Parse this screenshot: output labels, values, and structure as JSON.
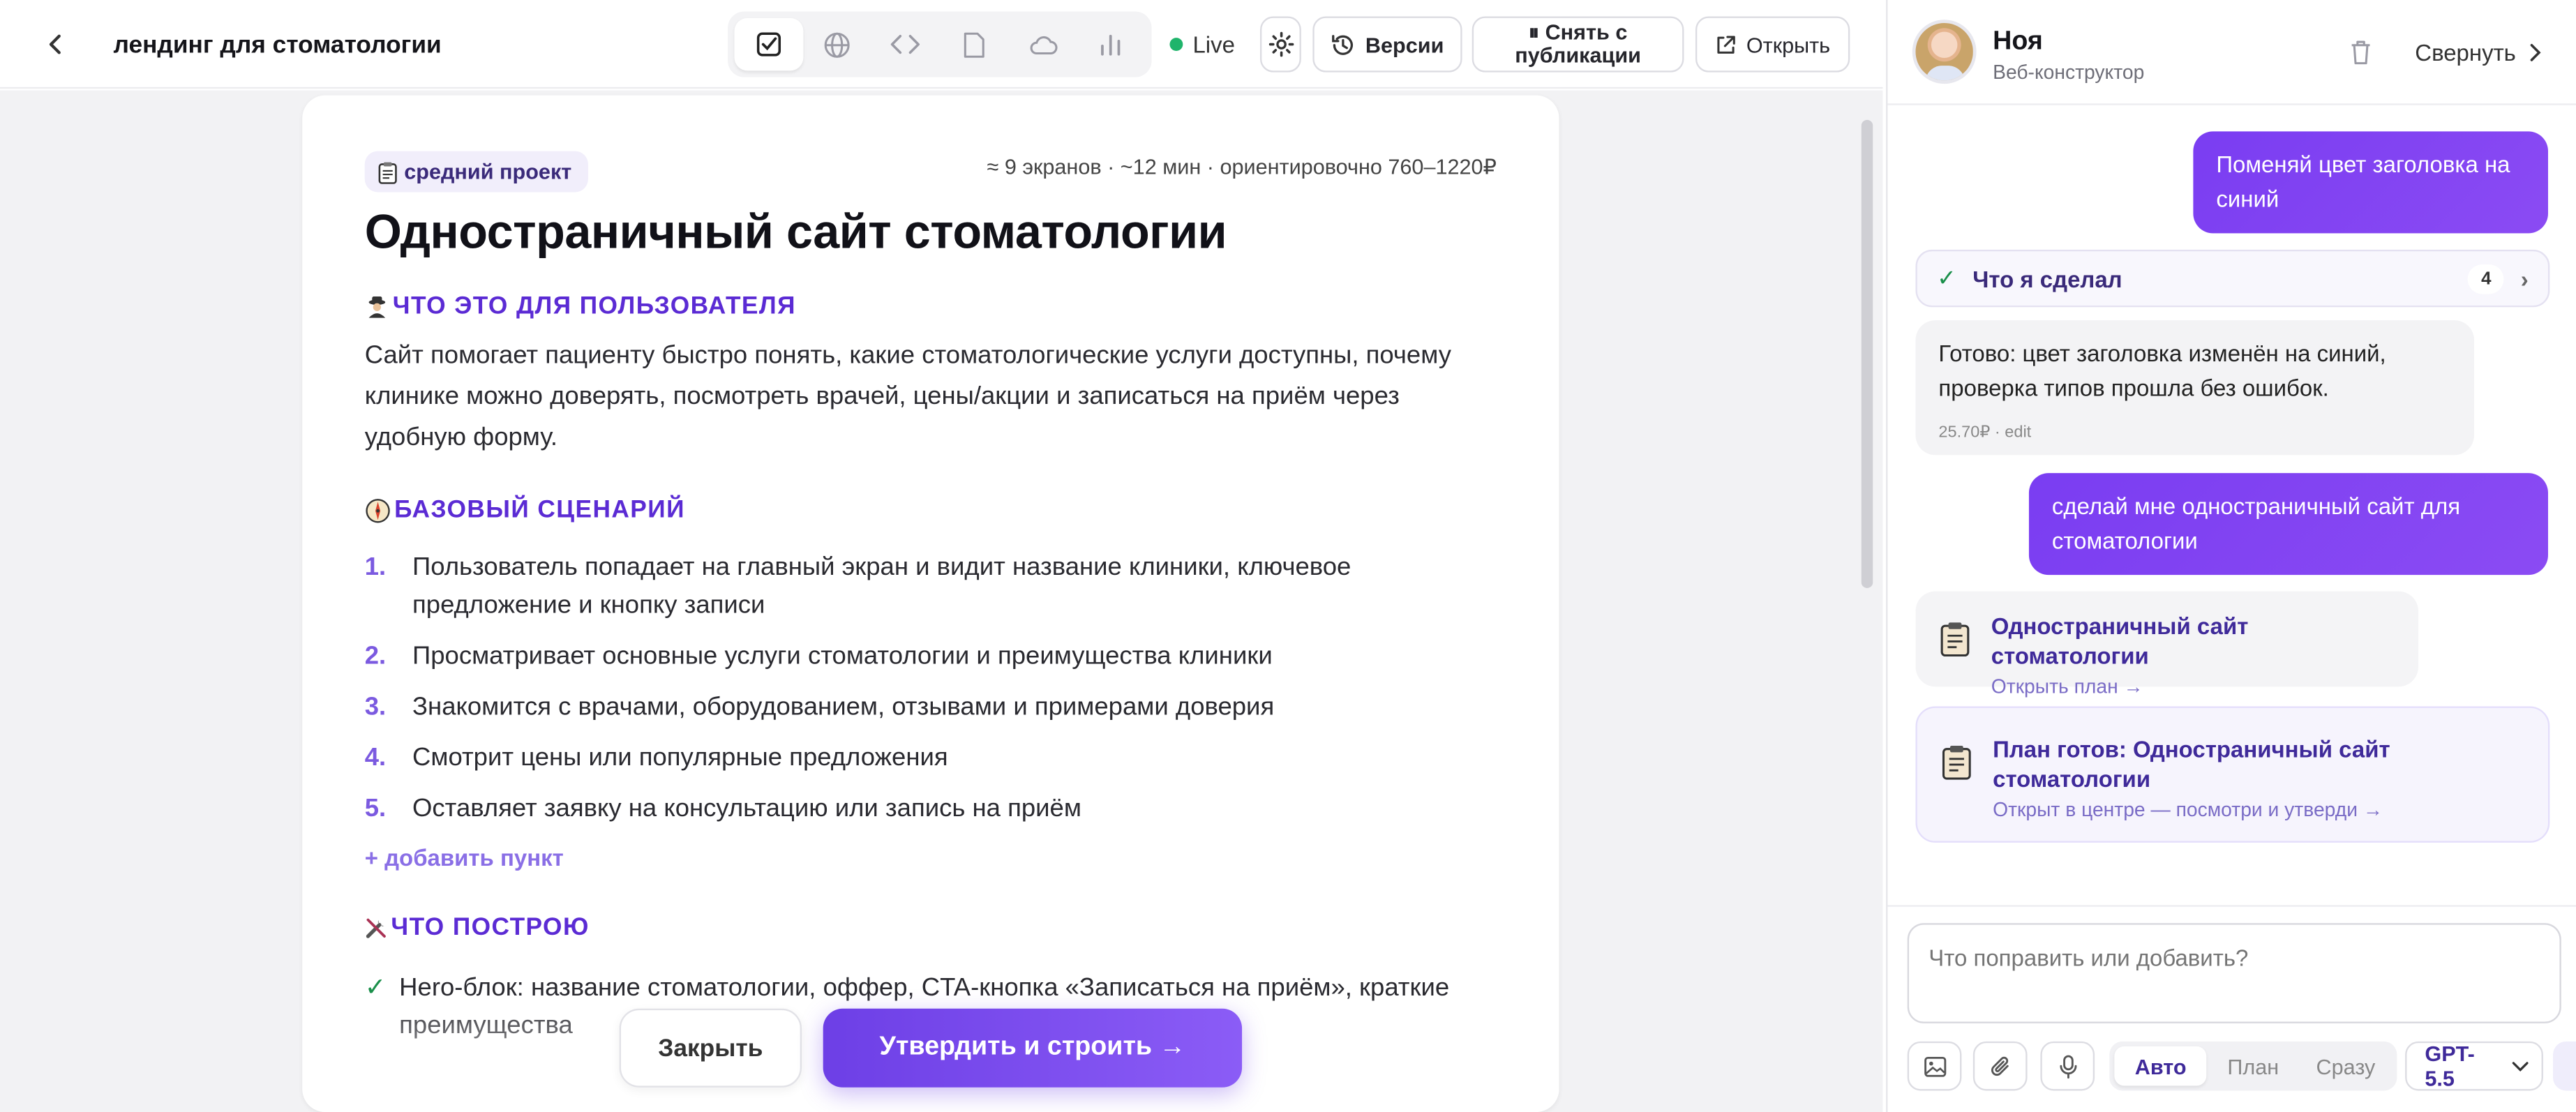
{
  "topbar": {
    "project_title": "лендинг для стоматологии",
    "live_label": "Live",
    "versions_label": "Версии",
    "unpublish_label": "⏸ Снять с публикации",
    "open_label": "Открыть",
    "modes": [
      "checklist-icon",
      "globe-icon",
      "code-icon",
      "file-icon",
      "cloud-icon",
      "chart-icon"
    ],
    "accent_live": "#1fb46b"
  },
  "plan": {
    "badge": "средний проект",
    "meta": "≈ 9 экранов · ~12 мин · ориентировочно 760–1220₽",
    "title": "Одностраничный сайт стоматологии",
    "section_user": "ЧТО ЭТО ДЛЯ ПОЛЬЗОВАТЕЛЯ",
    "user_text": "Сайт помогает пациенту быстро понять, какие стоматологические услуги доступны, почему клинике можно доверять, посмотреть врачей, цены/акции и записаться на приём через удобную форму.",
    "section_scenario": "БАЗОВЫЙ СЦЕНАРИЙ",
    "steps": [
      {
        "num": "1.",
        "text": "Пользователь попадает на главный экран и видит название клиники, ключевое предложение и кнопку записи"
      },
      {
        "num": "2.",
        "text": "Просматривает основные услуги стоматологии и преимущества клиники"
      },
      {
        "num": "3.",
        "text": "Знакомится с врачами, оборудованием, отзывами и примерами доверия"
      },
      {
        "num": "4.",
        "text": "Смотрит цены или популярные предложения"
      },
      {
        "num": "5.",
        "text": "Оставляет заявку на консультацию или запись на приём"
      }
    ],
    "add_item": "+ добавить пункт",
    "section_build": "ЧТО ПОСТРОЮ",
    "build_items": [
      "Hero-блок: название стоматологии, оффер, CTA-кнопка «Записаться на приём», краткие преимущества"
    ],
    "close_label": "Закрыть",
    "approve_label": "Утвердить и строить →",
    "accent": "#5b2bd4"
  },
  "chat": {
    "agent_name": "Ноя",
    "agent_role": "Веб-конструктор",
    "collapse_label": "Свернуть",
    "msg_user_1": "Поменяй цвет заголовка на синий",
    "did_label": "Что я сделал",
    "did_count": "4",
    "ai_reply": "Готово: цвет заголовка изменён на синий, проверка типов прошла без ошибок.",
    "ai_cost": "25.70₽ · edit",
    "msg_user_2": "сделай мне одностраничный сайт для стоматологии",
    "plan_card_title": "Одностраничный сайт стоматологии",
    "plan_card_sub": "Открыть план →",
    "ready_card_title": "План готов: Одностраничный сайт стоматологии",
    "ready_card_sub": "Открыт в центре — посмотри и утверди →",
    "composer_placeholder": "Что поправить или добавить?",
    "modes": [
      "Авто",
      "План",
      "Сразу"
    ],
    "model": "GPT-5.5",
    "bubble_color": "#7a3df2"
  }
}
